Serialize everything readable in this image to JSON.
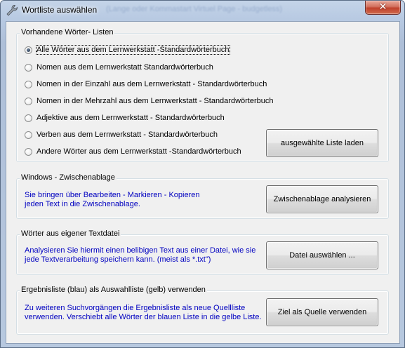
{
  "window": {
    "title": "Wortliste auswählen",
    "background_title_text": "(Lange oder Kommastart Virtuel Page - budgetless)",
    "close_label": "✕"
  },
  "word_lists": {
    "legend": "Vorhandene Wörter- Listen",
    "options": [
      {
        "label": "Alle Wörter aus dem Lernwerkstatt -Standardwörterbuch",
        "selected": true
      },
      {
        "label": "Nomen aus dem Lernwerkstatt Standardwörterbuch",
        "selected": false
      },
      {
        "label": "Nomen in der Einzahl aus dem Lernwerkstatt - Standardwörterbuch",
        "selected": false
      },
      {
        "label": "Nomen in der Mehrzahl aus dem Lernwerkstatt - Standardwörterbuch",
        "selected": false
      },
      {
        "label": "Adjektive aus dem Lernwerkstatt - Standardwörterbuch",
        "selected": false
      },
      {
        "label": "Verben aus dem Lernwerkstatt - Standardwörterbuch",
        "selected": false
      },
      {
        "label": "Andere Wörter aus dem Lernwerkstatt -Standardwörterbuch",
        "selected": false
      }
    ],
    "load_button": "ausgewählte Liste laden"
  },
  "clipboard": {
    "legend": "Windows - Zwischenablage",
    "description": "Sie bringen über Bearbeiten - Markieren - Kopieren\njeden Text in die Zwischenablage.",
    "button": "Zwischenablage analysieren"
  },
  "textfile": {
    "legend": "Wörter aus eigener Textdatei",
    "description": "Analysieren Sie hiermit einen belibigen Text aus einer Datei, wie sie\njede Textverarbeitung speichern kann. (meist als *.txt\")",
    "button": "Datei auswählen ..."
  },
  "result": {
    "legend": "Ergebnisliste (blau) als Auswahlliste (gelb) verwenden",
    "description": "Zu weiteren Suchvorgängen die Ergebnisliste als neue Quellliste\nverwenden. Verschiebt alle Wörter der blauen Liste in die gelbe Liste.",
    "button": "Ziel als Quelle verwenden"
  },
  "colors": {
    "description_text": "#0000c0",
    "close_button": "#c7432c",
    "title_bar": "#b9cbe3"
  }
}
